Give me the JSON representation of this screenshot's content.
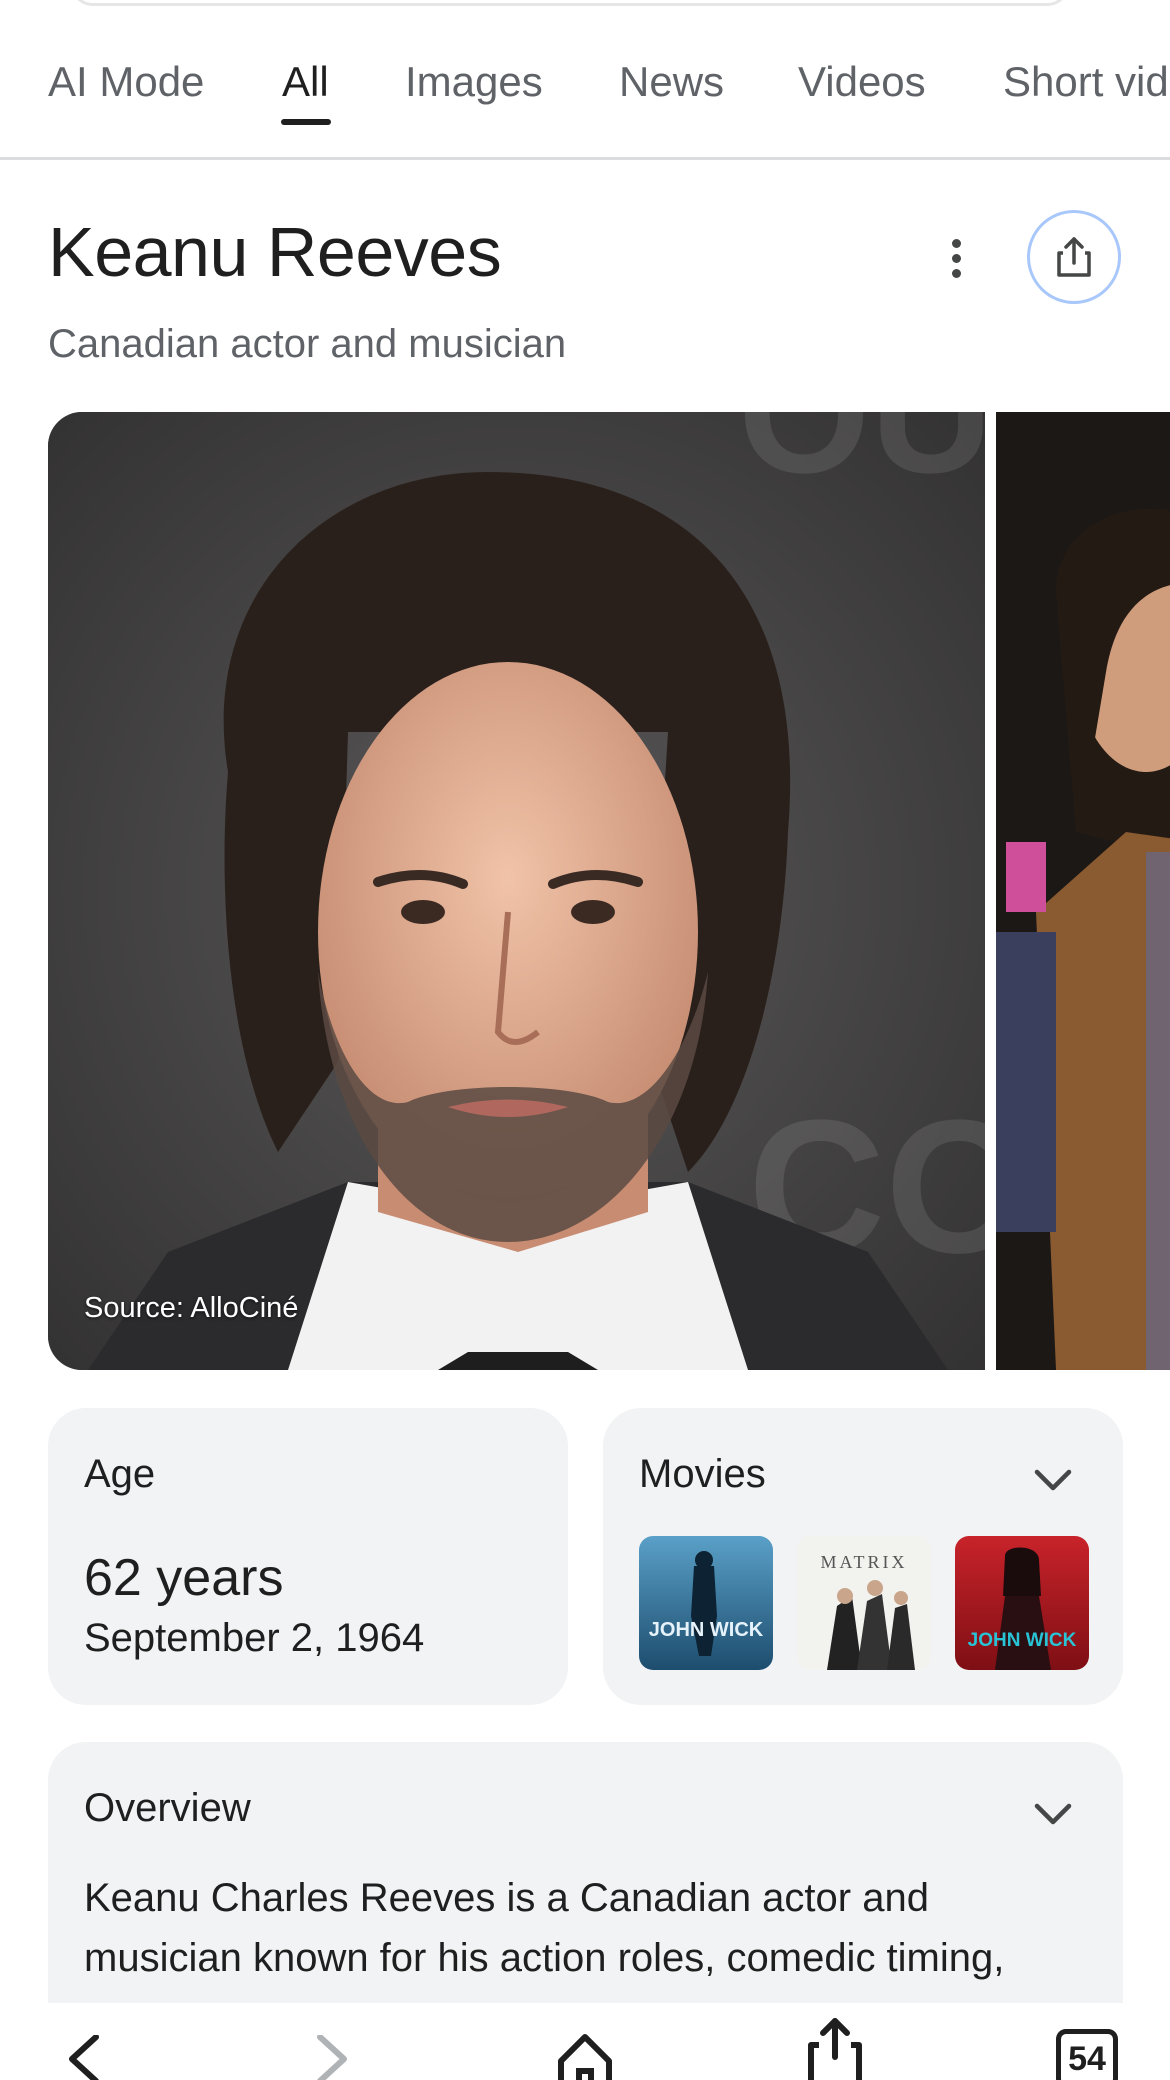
{
  "tabs": [
    {
      "label": "AI Mode"
    },
    {
      "label": "All"
    },
    {
      "label": "Images"
    },
    {
      "label": "News"
    },
    {
      "label": "Videos"
    },
    {
      "label": "Short vid"
    }
  ],
  "entity": {
    "title": "Keanu Reeves",
    "subtitle": "Canadian actor and musician"
  },
  "images": {
    "main_source": "Source: AlloCiné"
  },
  "age_card": {
    "label": "Age",
    "value": "62 years",
    "date": "September 2, 1964"
  },
  "movies_card": {
    "label": "Movies",
    "posters": [
      {
        "name": "John Wick",
        "text": "JOHN WICK"
      },
      {
        "name": "The Matrix",
        "text": "MATRIX"
      },
      {
        "name": "John Wick: Chapter 4",
        "text": "JOHN WICK"
      }
    ]
  },
  "overview_card": {
    "label": "Overview",
    "text": "Keanu Charles Reeves is a Canadian actor and musician known for his action roles, comedic timing,"
  },
  "bottom_nav": {
    "tab_count": "54"
  },
  "colors": {
    "accent_border": "#a8c7fa",
    "card_bg": "#f1f3f4",
    "muted_text": "#5f6368"
  }
}
